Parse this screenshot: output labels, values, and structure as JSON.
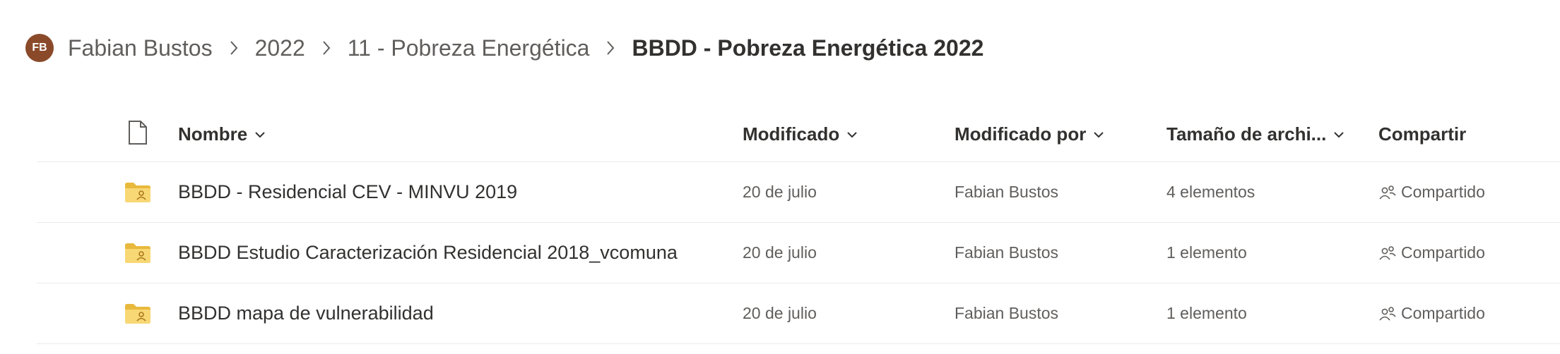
{
  "breadcrumb": {
    "avatar_initials": "FB",
    "items": [
      {
        "label": "Fabian Bustos"
      },
      {
        "label": "2022"
      },
      {
        "label": "11 - Pobreza Energética"
      },
      {
        "label": "BBDD - Pobreza Energética 2022"
      }
    ]
  },
  "columns": {
    "file_type_icon": "document-icon",
    "name": "Nombre",
    "modified": "Modificado",
    "modified_by": "Modificado por",
    "file_size": "Tamaño de archi...",
    "sharing": "Compartir"
  },
  "rows": [
    {
      "icon": "shared-folder-icon",
      "name": "BBDD - Residencial CEV - MINVU 2019",
      "modified": "20 de julio",
      "modified_by": "Fabian Bustos",
      "size": "4 elementos",
      "sharing": "Compartido"
    },
    {
      "icon": "shared-folder-icon",
      "name": "BBDD Estudio Caracterización Residencial 2018_vcomuna",
      "modified": "20 de julio",
      "modified_by": "Fabian Bustos",
      "size": "1 elemento",
      "sharing": "Compartido"
    },
    {
      "icon": "shared-folder-icon",
      "name": "BBDD mapa de vulnerabilidad",
      "modified": "20 de julio",
      "modified_by": "Fabian Bustos",
      "size": "1 elemento",
      "sharing": "Compartido"
    }
  ],
  "colors": {
    "avatar": "#8a4a2a",
    "folder": "#f8d775",
    "folder_dark": "#e8b93c",
    "divider": "#edebe9"
  }
}
